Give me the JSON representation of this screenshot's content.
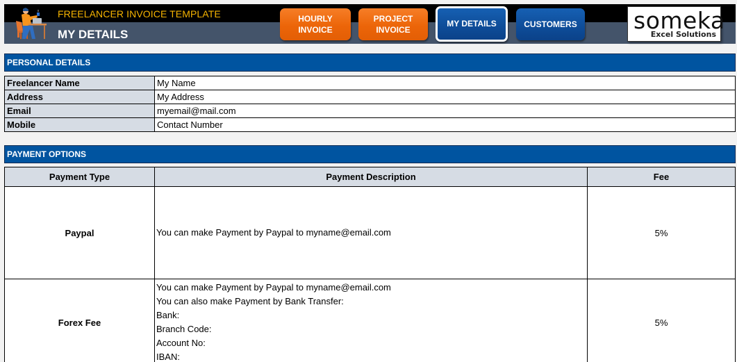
{
  "header": {
    "app_title": "FREELANCER INVOICE TEMPLATE",
    "page_title": "MY DETAILS",
    "nav": [
      {
        "label": "HOURLY\nINVOICE",
        "color": "#ec6509",
        "active": false
      },
      {
        "label": "PROJECT\nINVOICE",
        "color": "#ec6509",
        "active": false
      },
      {
        "label": "MY DETAILS",
        "color": "#0e4c98",
        "active": true
      },
      {
        "label": "CUSTOMERS",
        "color": "#0e4c98",
        "active": false
      }
    ],
    "brand": {
      "name": "someka",
      "tagline": "Excel Solutions"
    }
  },
  "personal_details": {
    "title": "PERSONAL DETAILS",
    "rows": [
      {
        "label": "Freelancer Name",
        "value": "My Name"
      },
      {
        "label": "Address",
        "value": "My Address"
      },
      {
        "label": "Email",
        "value": "myemail@mail.com"
      },
      {
        "label": "Mobile",
        "value": "Contact Number"
      }
    ]
  },
  "payment_options": {
    "title": "PAYMENT OPTIONS",
    "columns": [
      "Payment Type",
      "Payment Description",
      "Fee"
    ],
    "rows": [
      {
        "type": "Paypal",
        "description": [
          "You can make Payment by Paypal to myname@email.com"
        ],
        "fee": "5%"
      },
      {
        "type": "Forex Fee",
        "description": [
          "You can make Payment by Paypal to myname@email.com",
          "You can also make Payment by Bank Transfer:",
          "Bank:",
          "Branch Code:",
          "Account No:",
          "IBAN:"
        ],
        "fee": "5%"
      }
    ]
  },
  "colors": {
    "section_bar": "#0054a0",
    "header_dark": "#000000",
    "header_slate": "#44546a",
    "app_title": "#f6b400",
    "label_cell": "#d6dce4"
  }
}
